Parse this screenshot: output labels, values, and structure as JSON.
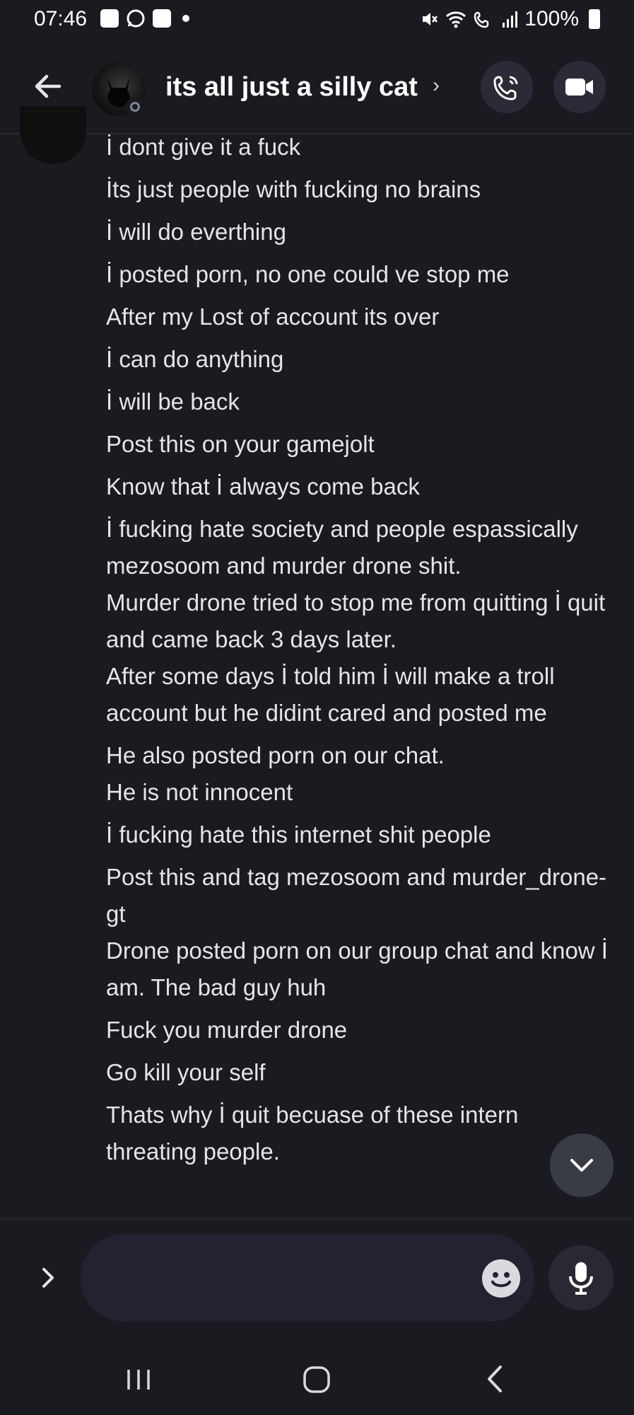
{
  "status_bar": {
    "time": "07:46",
    "battery": "100%"
  },
  "header": {
    "chat_title": "its all just a silly cat",
    "title_chevron": "›"
  },
  "messages": [
    "İ dont give it a fuck",
    "İts just people with fucking no brains",
    "İ will do everthing",
    "İ posted porn, no one could ve stop me",
    "After my Lost of account its over",
    "İ can do anything",
    "İ will be back",
    "Post this on your gamejolt",
    "Know that İ always come back",
    "İ fucking hate society and people espassically mezosoom and murder drone shit.",
    "Murder drone tried to stop me from quitting İ quit and came back 3 days later.",
    "After some days İ told him İ will make a troll account but he didint cared and posted me",
    "He also posted porn on our chat.",
    "He is not innocent",
    "İ fucking hate this internet shit people",
    "Post this and tag mezosoom and murder_drone-gt",
    "Drone posted porn on our group chat and know İ am. The bad guy huh",
    "Fuck you murder drone",
    "Go kill your self",
    "Thats why İ quit becuase of these intern threating people."
  ],
  "composer": {
    "placeholder": ""
  },
  "icons": {
    "back": "arrow-left-icon",
    "call": "phone-call-icon",
    "video": "video-camera-icon",
    "scroll": "chevron-down-icon",
    "expand": "chevron-right-icon",
    "emoji": "smiley-icon",
    "mic": "microphone-icon"
  },
  "colors": {
    "background": "#1a1b20",
    "input_bg": "#252131",
    "button_bg": "#2b2b38"
  }
}
